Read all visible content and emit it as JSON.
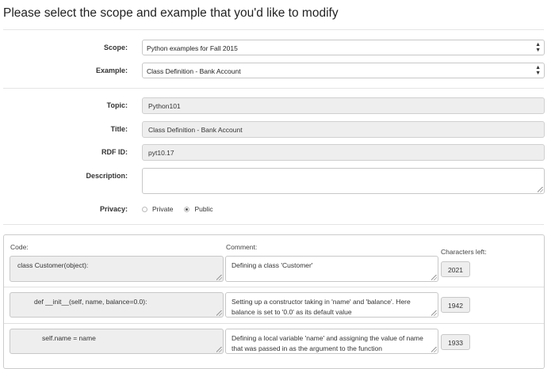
{
  "page": {
    "title": "Please select the scope and example that you'd like to modify"
  },
  "selectors": {
    "scope_label": "Scope:",
    "scope_value": "Python examples for Fall 2015",
    "example_label": "Example:",
    "example_value": "Class Definition - Bank Account"
  },
  "details": {
    "topic_label": "Topic:",
    "topic_value": "Python101",
    "title_label": "Title:",
    "title_value": "Class Definition - Bank Account",
    "rdf_label": "RDF ID:",
    "rdf_value": "pyt10.17",
    "description_label": "Description:",
    "description_value": "",
    "privacy_label": "Privacy:",
    "privacy_options": [
      "Private",
      "Public"
    ],
    "privacy_selected": "Public"
  },
  "code_table": {
    "code_header": "Code:",
    "comment_header": "Comment:",
    "chars_header": "Characters left:",
    "rows": [
      {
        "code": "class Customer(object):",
        "comment": "Defining a class 'Customer'",
        "chars_left": "2021"
      },
      {
        "code": "    def __init__(self, name, balance=0.0):",
        "comment": "Setting up a constructor taking in 'name' and 'balance'. Here balance is set to '0.0' as its default value",
        "chars_left": "1942"
      },
      {
        "code": "        self.name = name",
        "comment": "Defining a local variable 'name' and assigning the value of name that was passed in as the argument to the function",
        "chars_left": "1933"
      }
    ]
  },
  "icons": {
    "select_arrow": "up-down-arrows-icon",
    "resize": "resize-grip-icon"
  }
}
